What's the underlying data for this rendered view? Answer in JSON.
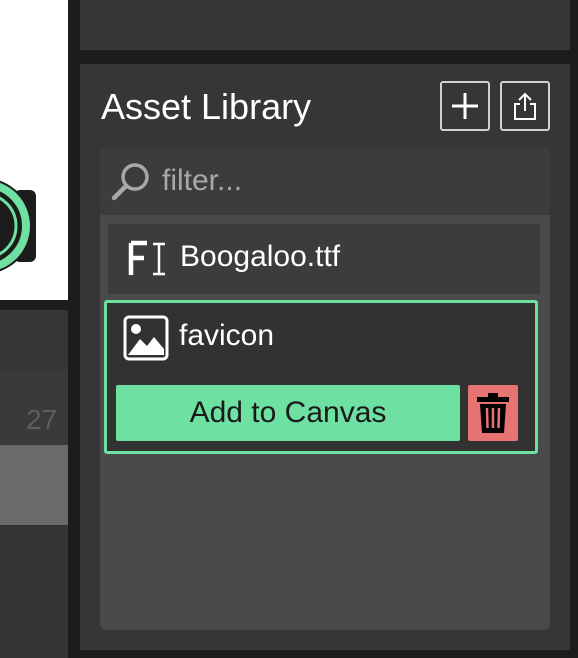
{
  "asset_library": {
    "title": "Asset Library",
    "add_icon": "plus-icon",
    "export_icon": "share-export-icon",
    "filter": {
      "placeholder": "filter...",
      "value": ""
    },
    "items": [
      {
        "type": "font",
        "icon": "font-icon",
        "label": "Boogaloo.ttf"
      },
      {
        "type": "image",
        "icon": "image-icon",
        "label": "favicon",
        "selected": true,
        "add_label": "Add to Canvas",
        "delete_icon": "trash-icon"
      }
    ]
  },
  "timeline": {
    "frame_number": "27"
  },
  "colors": {
    "accent": "#6ee0a1",
    "danger": "#e87373",
    "panel": "#363636"
  }
}
